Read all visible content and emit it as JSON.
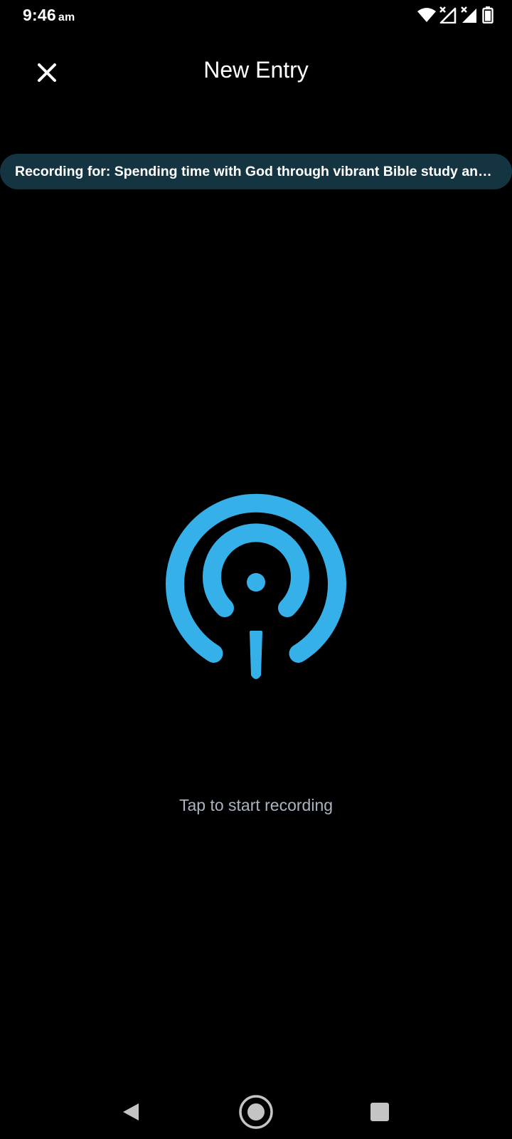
{
  "status_bar": {
    "time": "9:46",
    "ampm": "am",
    "icons": [
      "wifi-icon",
      "signal-no-service-icon",
      "signal-no-service-icon",
      "battery-icon"
    ]
  },
  "header": {
    "close_icon": "close-icon",
    "title": "New Entry"
  },
  "banner": {
    "text": "Recording for: Spending time with God through vibrant Bible study and..."
  },
  "recorder": {
    "icon": "podcast-mic-icon",
    "hint": "Tap to start recording",
    "accent_color": "#35b0e8"
  },
  "nav_bar": {
    "items": [
      "back-icon",
      "home-icon",
      "recents-icon"
    ]
  },
  "colors": {
    "background": "#000000",
    "banner_bg": "#153442",
    "hint_text": "#a9b3c1"
  }
}
